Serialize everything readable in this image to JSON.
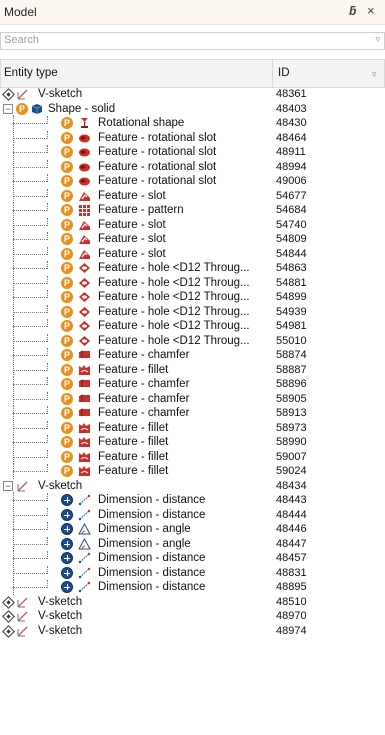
{
  "panel": {
    "title": "Model",
    "pin_glyph": "ƃ",
    "close_glyph": "×"
  },
  "search": {
    "placeholder": "Search",
    "value": ""
  },
  "columns": {
    "entity": "Entity type",
    "id": "ID"
  },
  "colors": {
    "orange_badge": "#e8901e",
    "blue_badge": "#1c4e8d",
    "solid_icon": "#1c4e8d",
    "feature_red": "#c9302c"
  },
  "rows": [
    {
      "label": "V-sketch",
      "id": "48361",
      "kind": "sketch-root",
      "icon": "sketch-icon",
      "state": "diamond"
    },
    {
      "label": "Shape - solid",
      "id": "48403",
      "kind": "shape-root",
      "icon": "solid-icon",
      "state": "minus"
    },
    {
      "label": "Rotational shape",
      "id": "48430",
      "kind": "feature",
      "icon": "rotational-shape-icon"
    },
    {
      "label": "Feature - rotational slot",
      "id": "48464",
      "kind": "feature",
      "icon": "rotational-slot-icon"
    },
    {
      "label": "Feature - rotational slot",
      "id": "48911",
      "kind": "feature",
      "icon": "rotational-slot-icon"
    },
    {
      "label": "Feature - rotational slot",
      "id": "48994",
      "kind": "feature",
      "icon": "rotational-slot-icon"
    },
    {
      "label": "Feature - rotational slot",
      "id": "49006",
      "kind": "feature",
      "icon": "rotational-slot-icon"
    },
    {
      "label": "Feature - slot",
      "id": "54677",
      "kind": "feature",
      "icon": "slot-icon"
    },
    {
      "label": "Feature - pattern",
      "id": "54684",
      "kind": "feature",
      "icon": "pattern-icon"
    },
    {
      "label": "Feature - slot",
      "id": "54740",
      "kind": "feature",
      "icon": "slot-icon"
    },
    {
      "label": "Feature - slot",
      "id": "54809",
      "kind": "feature",
      "icon": "slot-icon"
    },
    {
      "label": "Feature - slot",
      "id": "54844",
      "kind": "feature",
      "icon": "slot-icon"
    },
    {
      "label": "Feature - hole <D12 Throug...",
      "id": "54863",
      "kind": "feature",
      "icon": "hole-icon"
    },
    {
      "label": "Feature - hole <D12 Throug...",
      "id": "54881",
      "kind": "feature",
      "icon": "hole-icon"
    },
    {
      "label": "Feature - hole <D12 Throug...",
      "id": "54899",
      "kind": "feature",
      "icon": "hole-icon"
    },
    {
      "label": "Feature - hole <D12 Throug...",
      "id": "54939",
      "kind": "feature",
      "icon": "hole-icon"
    },
    {
      "label": "Feature - hole <D12 Throug...",
      "id": "54981",
      "kind": "feature",
      "icon": "hole-icon"
    },
    {
      "label": "Feature - hole <D12 Throug...",
      "id": "55010",
      "kind": "feature",
      "icon": "hole-icon"
    },
    {
      "label": "Feature - chamfer",
      "id": "58874",
      "kind": "feature",
      "icon": "chamfer-icon"
    },
    {
      "label": "Feature - fillet",
      "id": "58887",
      "kind": "feature",
      "icon": "fillet-icon"
    },
    {
      "label": "Feature - chamfer",
      "id": "58896",
      "kind": "feature",
      "icon": "chamfer-icon"
    },
    {
      "label": "Feature - chamfer",
      "id": "58905",
      "kind": "feature",
      "icon": "chamfer-icon"
    },
    {
      "label": "Feature - chamfer",
      "id": "58913",
      "kind": "feature",
      "icon": "chamfer-icon"
    },
    {
      "label": "Feature - fillet",
      "id": "58973",
      "kind": "feature",
      "icon": "fillet-icon"
    },
    {
      "label": "Feature - fillet",
      "id": "58990",
      "kind": "feature",
      "icon": "fillet-icon"
    },
    {
      "label": "Feature - fillet",
      "id": "59007",
      "kind": "feature",
      "icon": "fillet-icon"
    },
    {
      "label": "Feature - fillet",
      "id": "59024",
      "kind": "feature",
      "icon": "fillet-icon"
    },
    {
      "label": "V-sketch",
      "id": "48434",
      "kind": "sketch-root",
      "icon": "sketch-icon",
      "state": "minus"
    },
    {
      "label": "Dimension - distance",
      "id": "48443",
      "kind": "dimension",
      "icon": "distance-icon"
    },
    {
      "label": "Dimension - distance",
      "id": "48444",
      "kind": "dimension",
      "icon": "distance-icon"
    },
    {
      "label": "Dimension - angle",
      "id": "48446",
      "kind": "dimension",
      "icon": "angle-icon"
    },
    {
      "label": "Dimension - angle",
      "id": "48447",
      "kind": "dimension",
      "icon": "angle-icon"
    },
    {
      "label": "Dimension - distance",
      "id": "48457",
      "kind": "dimension",
      "icon": "distance-icon"
    },
    {
      "label": "Dimension - distance",
      "id": "48831",
      "kind": "dimension",
      "icon": "distance-icon"
    },
    {
      "label": "Dimension - distance",
      "id": "48895",
      "kind": "dimension",
      "icon": "distance-icon"
    },
    {
      "label": "V-sketch",
      "id": "48510",
      "kind": "sketch-root",
      "icon": "sketch-icon",
      "state": "diamond"
    },
    {
      "label": "V-sketch",
      "id": "48970",
      "kind": "sketch-root",
      "icon": "sketch-icon",
      "state": "diamond"
    },
    {
      "label": "V-sketch",
      "id": "48974",
      "kind": "sketch-root",
      "icon": "sketch-icon",
      "state": "diamond"
    }
  ]
}
